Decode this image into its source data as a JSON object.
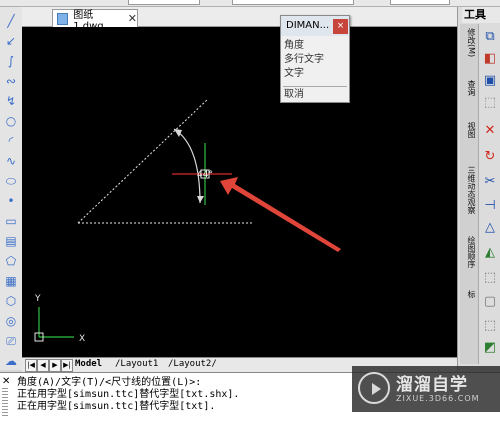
{
  "document_tab": {
    "title": "图纸1.dwg",
    "close": "✕"
  },
  "popup": {
    "title": "DIMAN...",
    "close": "×",
    "items": [
      "角度",
      "多行文字",
      "文字"
    ],
    "cancel": "取消"
  },
  "canvas": {
    "angle_label": "44°",
    "ucs_y": "Y",
    "ucs_x": "X"
  },
  "layout_tabs": [
    "Model",
    "Layout1",
    "Layout2"
  ],
  "right_panel": {
    "header": "工具",
    "vertical_labels": [
      "修改(M)",
      "查询",
      "视图",
      "三维动态观察",
      "绘图顺序",
      "标"
    ]
  },
  "command_lines": [
    "角度(A)/文字(T)/<尺寸线的位置(L)>:",
    "正在用字型[simsun.ttc]替代字型[txt.shx].",
    "正在用字型[simsun.ttc]替代字型[txt]."
  ],
  "watermark": {
    "title": "溜溜自学",
    "subtitle": "ZIXUE.3D66.COM"
  },
  "colors": {
    "canvas_bg": "#000000",
    "arrow": "#e0453a",
    "dim_green": "#2fbf3f",
    "dim_red": "#d62a2a",
    "popup_close": "#c7453b"
  }
}
